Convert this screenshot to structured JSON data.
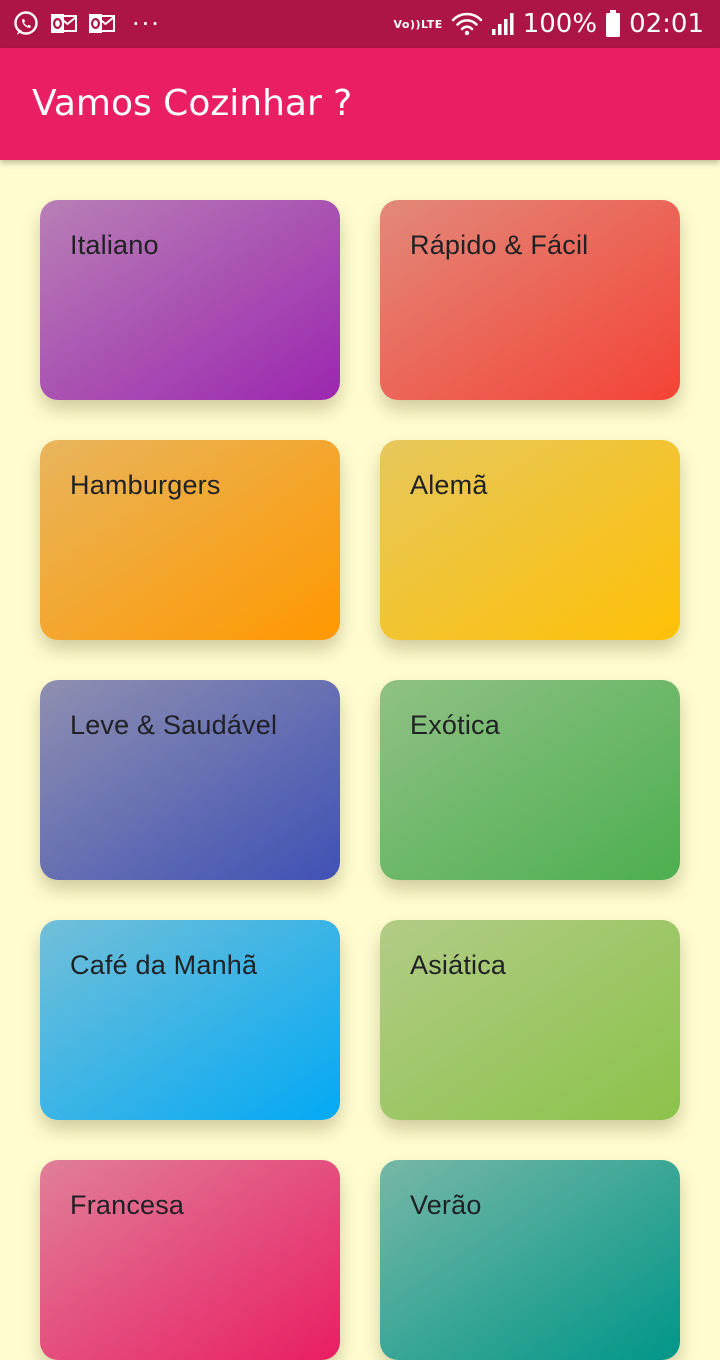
{
  "status_bar": {
    "battery": "100%",
    "time": "02:01",
    "volte_top": "Vo))",
    "volte_bottom": "LTE",
    "overflow": "···",
    "icons": [
      "whatsapp-icon",
      "outlook-icon",
      "outlook-icon",
      "more-notifications-icon",
      "volte-icon",
      "wifi-icon",
      "signal-icon",
      "battery-icon"
    ]
  },
  "app_bar": {
    "title": "Vamos Cozinhar ?",
    "color": "#e91e63"
  },
  "background_color": "#fffdd0",
  "categories": [
    {
      "label": "Italiano",
      "color_from": "#b87fb5",
      "color_to": "#9c27b0"
    },
    {
      "label": "Rápido & Fácil",
      "color_from": "#e2897a",
      "color_to": "#f44336"
    },
    {
      "label": "Hamburgers",
      "color_from": "#e8b55d",
      "color_to": "#ff9800"
    },
    {
      "label": "Alemã",
      "color_from": "#e6c75c",
      "color_to": "#ffc107"
    },
    {
      "label": "Leve & Saudável",
      "color_from": "#8f8fb0",
      "color_to": "#3f51b5"
    },
    {
      "label": "Exótica",
      "color_from": "#90c184",
      "color_to": "#4caf50"
    },
    {
      "label": "Café da Manhã",
      "color_from": "#73bfd8",
      "color_to": "#03a9f4"
    },
    {
      "label": "Asiática",
      "color_from": "#b2cb86",
      "color_to": "#8bc34a"
    },
    {
      "label": "Francesa",
      "color_from": "#e07f98",
      "color_to": "#e91e63"
    },
    {
      "label": "Verão",
      "color_from": "#77b7a6",
      "color_to": "#009688"
    }
  ]
}
